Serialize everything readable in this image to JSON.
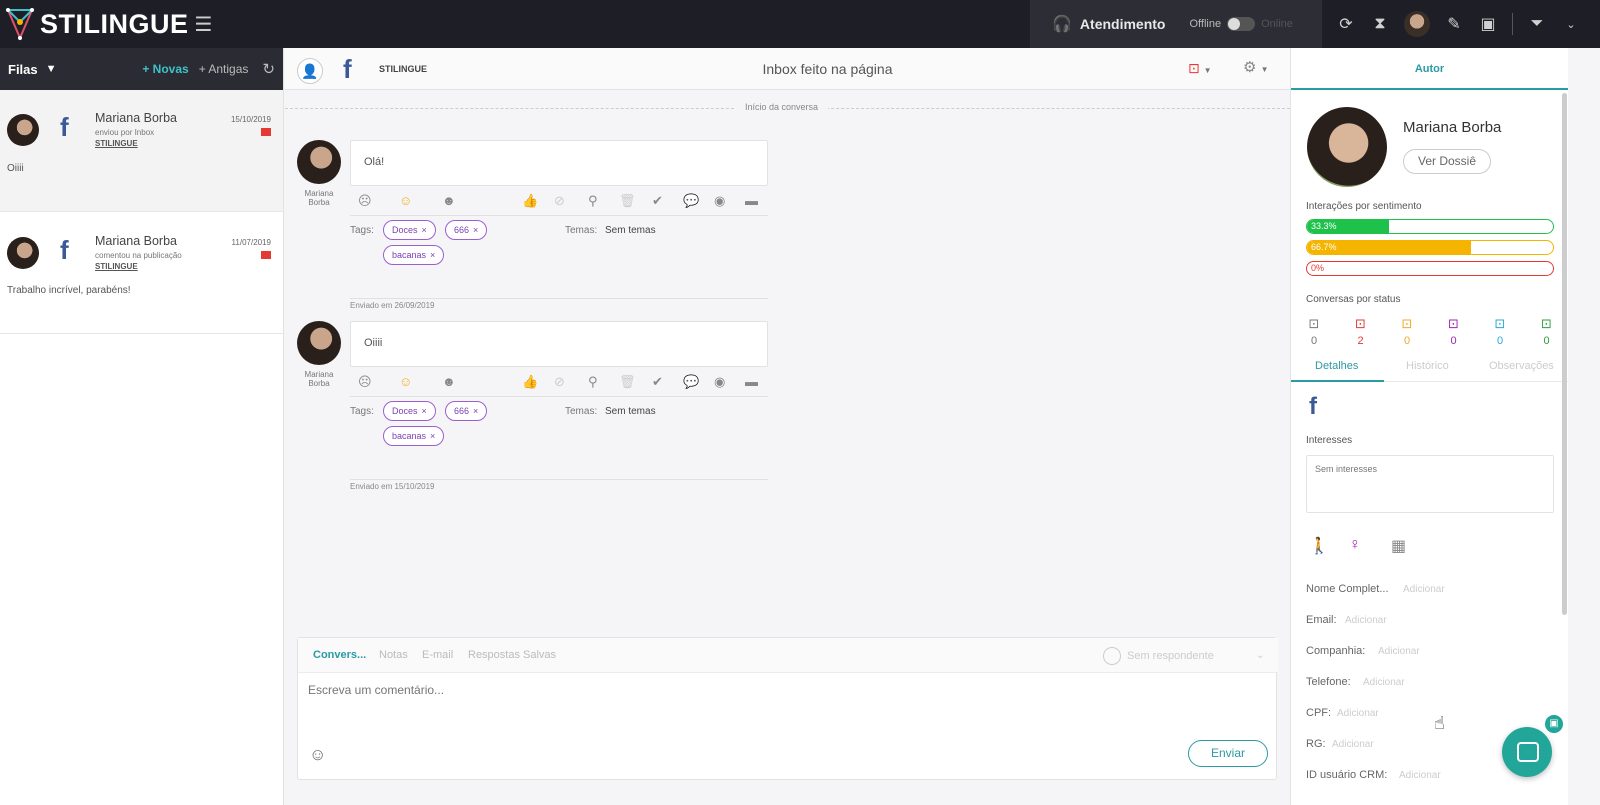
{
  "app": {
    "name": "STILINGUE"
  },
  "topbar": {
    "atendimento": "Atendimento",
    "offline": "Offline",
    "online": "Online"
  },
  "left": {
    "filas": "Filas",
    "novas": "+ Novas",
    "antigas": "+ Antigas",
    "conversations": [
      {
        "name": "Mariana Borba",
        "date": "15/10/2019",
        "sub": "enviou por Inbox",
        "page": "STILINGUE",
        "msg": "Oiiii"
      },
      {
        "name": "Mariana Borba",
        "date": "11/07/2019",
        "sub": "comentou na publicação",
        "page": "STILINGUE",
        "msg": "Trabalho incrível, parabéns!"
      }
    ]
  },
  "center": {
    "page": "STILINGUE",
    "title": "Inbox feito na página",
    "start_label": "Início da conversa",
    "messages": [
      {
        "author_first": "Mariana",
        "author_last": "Borba",
        "text": "Olá!",
        "tags": [
          "Doces",
          "666",
          "bacanas"
        ],
        "tags_label": "Tags:",
        "temas_label": "Temas:",
        "temas": "Sem temas",
        "sent": "Enviado em 26/09/2019"
      },
      {
        "author_first": "Mariana",
        "author_last": "Borba",
        "text": "Oiiii",
        "tags": [
          "Doces",
          "666",
          "bacanas"
        ],
        "tags_label": "Tags:",
        "temas_label": "Temas:",
        "temas": "Sem temas",
        "sent": "Enviado em 15/10/2019"
      }
    ]
  },
  "composer": {
    "tabs": [
      "Convers...",
      "Notas",
      "E-mail",
      "Respostas Salvas"
    ],
    "no_responder": "Sem respondente",
    "placeholder": "Escreva um comentário...",
    "send": "Enviar"
  },
  "right": {
    "tab": "Autor",
    "name": "Mariana Borba",
    "dossie": "Ver Dossiê",
    "sent_title": "Interações por sentimento",
    "sentiments": [
      {
        "label": "33.3%",
        "value": 33.3,
        "color": "#1ec24a"
      },
      {
        "label": "66.7%",
        "value": 66.7,
        "color": "#f5b400"
      },
      {
        "label": "0%",
        "value": 0,
        "color": "#e53935"
      }
    ],
    "status_title": "Conversas por status",
    "statuses": [
      {
        "count": "0",
        "color": "#777777"
      },
      {
        "count": "2",
        "color": "#e53935"
      },
      {
        "count": "0",
        "color": "#f5a623"
      },
      {
        "count": "0",
        "color": "#9c27b0"
      },
      {
        "count": "0",
        "color": "#29a9d8"
      },
      {
        "count": "0",
        "color": "#2e9e3b"
      }
    ],
    "tabs": [
      "Detalhes",
      "Histórico",
      "Observações"
    ],
    "interesses_label": "Interesses",
    "interesses_value": "Sem interesses",
    "fields": [
      {
        "label": "Nome Complet...",
        "add": "Adicionar"
      },
      {
        "label": "Email:",
        "add": "Adicionar"
      },
      {
        "label": "Companhia:",
        "add": "Adicionar"
      },
      {
        "label": "Telefone:",
        "add": "Adicionar"
      },
      {
        "label": "CPF:",
        "add": "Adicionar"
      },
      {
        "label": "RG:",
        "add": "Adicionar"
      },
      {
        "label": "ID usuário CRM:",
        "add": "Adicionar"
      }
    ]
  }
}
